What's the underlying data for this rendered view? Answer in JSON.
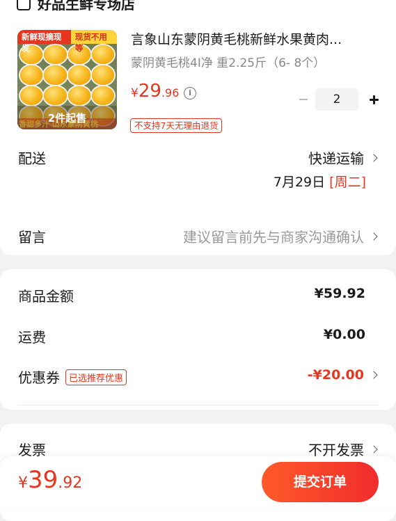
{
  "store": {
    "name": "好品生鲜专场店"
  },
  "product": {
    "thumb_tag_left": "新鲜现摘现发",
    "thumb_tag_right": "现货不用等",
    "thumb_ribbon": "香甜多汁 山东蒙阴黄桃",
    "min_qty_label": "2件起售",
    "title": "言象山东蒙阴黄毛桃新鲜水果黄肉...",
    "spec": "蒙阴黄毛桃4Ⅰ净 重2.25斤（6- 8个）",
    "price_currency": "¥",
    "price_int": "29",
    "price_dec": ".96",
    "info_icon": "i",
    "no_return_label": "不支持7天无理由退货",
    "quantity": "2"
  },
  "delivery": {
    "label": "配送",
    "method": "快递运输",
    "date": "7月29日",
    "weekday": "[周二]"
  },
  "note": {
    "label": "留言",
    "placeholder": "建议留言前先与商家沟通确认"
  },
  "price_detail": {
    "goods_label": "商品金额",
    "goods_value": "¥59.92",
    "shipping_label": "运费",
    "shipping_value": "¥0.00",
    "coupon_label": "优惠券",
    "coupon_tag": "已选推荐优惠",
    "coupon_value": "-¥20.00"
  },
  "invoice": {
    "label": "发票",
    "value": "不开发票"
  },
  "footer": {
    "total_currency": "¥",
    "total_int": "39",
    "total_dec": ".92",
    "submit_label": "提交订单"
  },
  "colors": {
    "accent": "#e5361f",
    "submit_gradient_start": "#ff5a2a",
    "submit_gradient_end": "#f02c2c"
  },
  "icons": [
    "store-icon",
    "info-icon",
    "chevron-right-icon",
    "minus-icon",
    "plus-icon"
  ]
}
